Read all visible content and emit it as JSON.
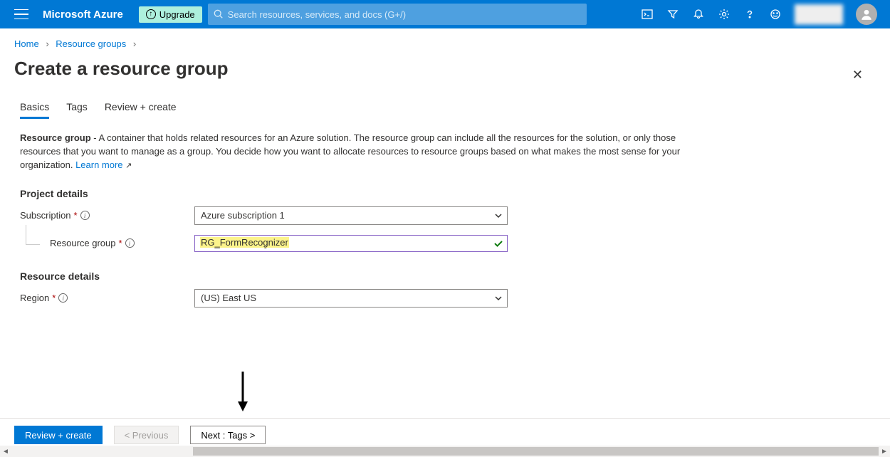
{
  "header": {
    "logo": "Microsoft Azure",
    "upgrade": "Upgrade",
    "search_placeholder": "Search resources, services, and docs (G+/)"
  },
  "breadcrumb": {
    "items": [
      "Home",
      "Resource groups"
    ]
  },
  "page_title": "Create a resource group",
  "tabs": {
    "items": [
      "Basics",
      "Tags",
      "Review + create"
    ],
    "active_index": 0
  },
  "description": {
    "bold": "Resource group",
    "text": " - A container that holds related resources for an Azure solution. The resource group can include all the resources for the solution, or only those resources that you want to manage as a group. You decide how you want to allocate resources to resource groups based on what makes the most sense for your organization. ",
    "link": "Learn more"
  },
  "sections": {
    "project_details": {
      "title": "Project details",
      "subscription": {
        "label": "Subscription",
        "value": "Azure subscription 1"
      },
      "resource_group": {
        "label": "Resource group",
        "value": "RG_FormRecognizer"
      }
    },
    "resource_details": {
      "title": "Resource details",
      "region": {
        "label": "Region",
        "value": "(US) East US"
      }
    }
  },
  "footer": {
    "review": "Review + create",
    "previous": "< Previous",
    "next": "Next : Tags >"
  }
}
